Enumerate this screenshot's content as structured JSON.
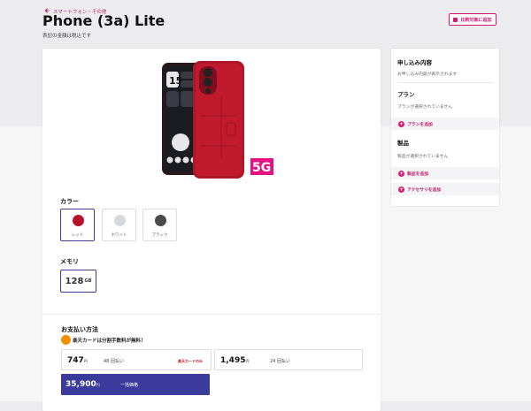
{
  "header": {
    "back_link": "スマートフォン・その他",
    "title": "Phone (3a) Lite",
    "subtitle": "表記の金額は税込です",
    "compare_button": "比較対象に追加"
  },
  "product": {
    "badge_5g": "5G",
    "phone_screen_time": "15"
  },
  "color_section": {
    "label": "カラー",
    "options": [
      {
        "name": "レッド",
        "color": "#b8122a",
        "selected": true
      },
      {
        "name": "ホワイト",
        "color": "#d8d9de",
        "selected": false
      },
      {
        "name": "ブラック",
        "color": "#4a4a4d",
        "selected": false
      }
    ]
  },
  "memory_section": {
    "label": "メモリ",
    "value": "128",
    "unit": "GB"
  },
  "payment": {
    "label": "お支払い方法",
    "card_note": "楽天カードは分割手数料が無料！",
    "options": [
      {
        "price": "747",
        "yen": "円",
        "label": "48 回払い",
        "tag": "楽天カードのみ"
      },
      {
        "price": "1,495",
        "yen": "円",
        "label": "24 回払い"
      },
      {
        "price": "35,900",
        "yen": "円",
        "label": "一括価格"
      }
    ]
  },
  "summary": {
    "application_title": "申し込み内容",
    "application_empty": "お申し込み内容が表示されます",
    "plan_title": "プラン",
    "plan_empty": "プランが選択されていません",
    "add_plan": "プランを追加",
    "product_title": "製品",
    "product_empty": "製品が選択されていません",
    "add_product": "製品を追加",
    "add_accessory": "アクセサリを追加"
  },
  "colors": {
    "accent": "#d4166f",
    "primary": "#3b3b9c"
  }
}
